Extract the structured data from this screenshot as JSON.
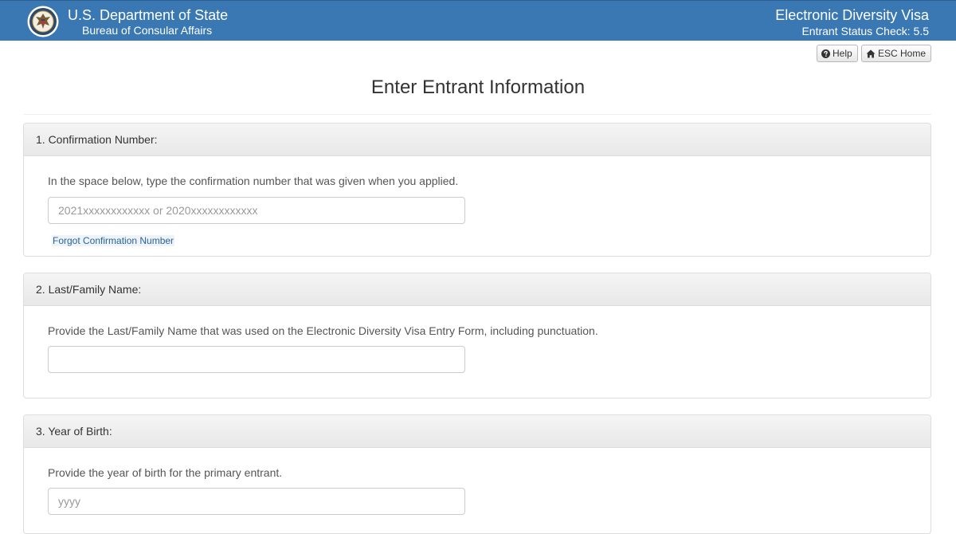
{
  "header": {
    "department": "U.S. Department of State",
    "bureau": "Bureau of Consular Affairs",
    "app_title": "Electronic Diversity Visa",
    "app_subtitle": "Entrant Status Check: 5.5"
  },
  "toolbar": {
    "help_label": "Help",
    "home_label": "ESC Home"
  },
  "page": {
    "title": "Enter Entrant Information"
  },
  "sections": [
    {
      "heading": "1. Confirmation Number:",
      "instruction": "In the space below, type the confirmation number that was given when you applied.",
      "placeholder": "2021xxxxxxxxxxxx or 2020xxxxxxxxxxxx",
      "value": "",
      "link_label": "Forgot Confirmation Number"
    },
    {
      "heading": "2. Last/Family Name:",
      "instruction": "Provide the Last/Family Name that was used on the Electronic Diversity Visa Entry Form, including punctuation.",
      "placeholder": "",
      "value": ""
    },
    {
      "heading": "3. Year of Birth:",
      "instruction": "Provide the year of birth for the primary entrant.",
      "placeholder": "yyyy",
      "value": ""
    }
  ],
  "colors": {
    "header_bar": "#3a78b3",
    "link": "#2a6496",
    "panel_border": "#dddddd"
  },
  "icons": {
    "seal": "department-seal-icon",
    "help": "question-circle-icon",
    "home": "home-icon"
  }
}
